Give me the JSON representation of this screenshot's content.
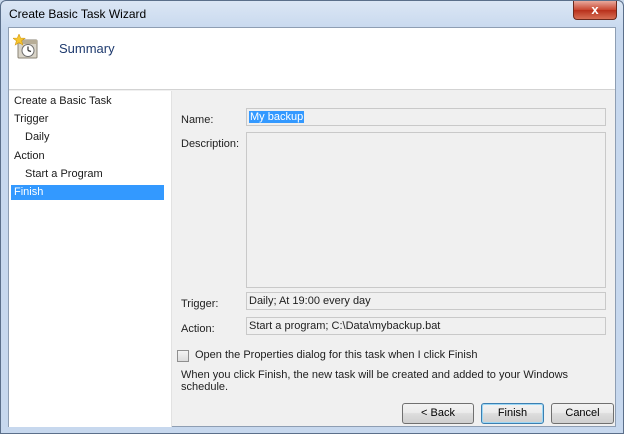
{
  "window": {
    "title": "Create Basic Task Wizard",
    "close_glyph": "x"
  },
  "header": {
    "title": "Summary",
    "icon": "task-scheduler-icon"
  },
  "nav": {
    "items": [
      {
        "label": "Create a Basic Task",
        "level": 0,
        "selected": false
      },
      {
        "label": "Trigger",
        "level": 0,
        "selected": false
      },
      {
        "label": "Daily",
        "level": 1,
        "selected": false
      },
      {
        "label": "Action",
        "level": 0,
        "selected": false
      },
      {
        "label": "Start a Program",
        "level": 1,
        "selected": false
      },
      {
        "label": "Finish",
        "level": 0,
        "selected": true
      }
    ]
  },
  "summary": {
    "name_label": "Name:",
    "name_value": "My backup",
    "description_label": "Description:",
    "description_value": "",
    "trigger_label": "Trigger:",
    "trigger_value": "Daily; At 19:00 every day",
    "action_label": "Action:",
    "action_value": "Start a program; C:\\Data\\mybackup.bat"
  },
  "options": {
    "open_properties_label": "Open the Properties dialog for this task when I click Finish",
    "open_properties_checked": false,
    "info_text": "When you click Finish, the new task will be created and added to your Windows schedule."
  },
  "buttons": {
    "back": "< Back",
    "finish": "Finish",
    "cancel": "Cancel"
  },
  "colors": {
    "selection": "#3399ff",
    "header_title": "#1e3a6e"
  }
}
